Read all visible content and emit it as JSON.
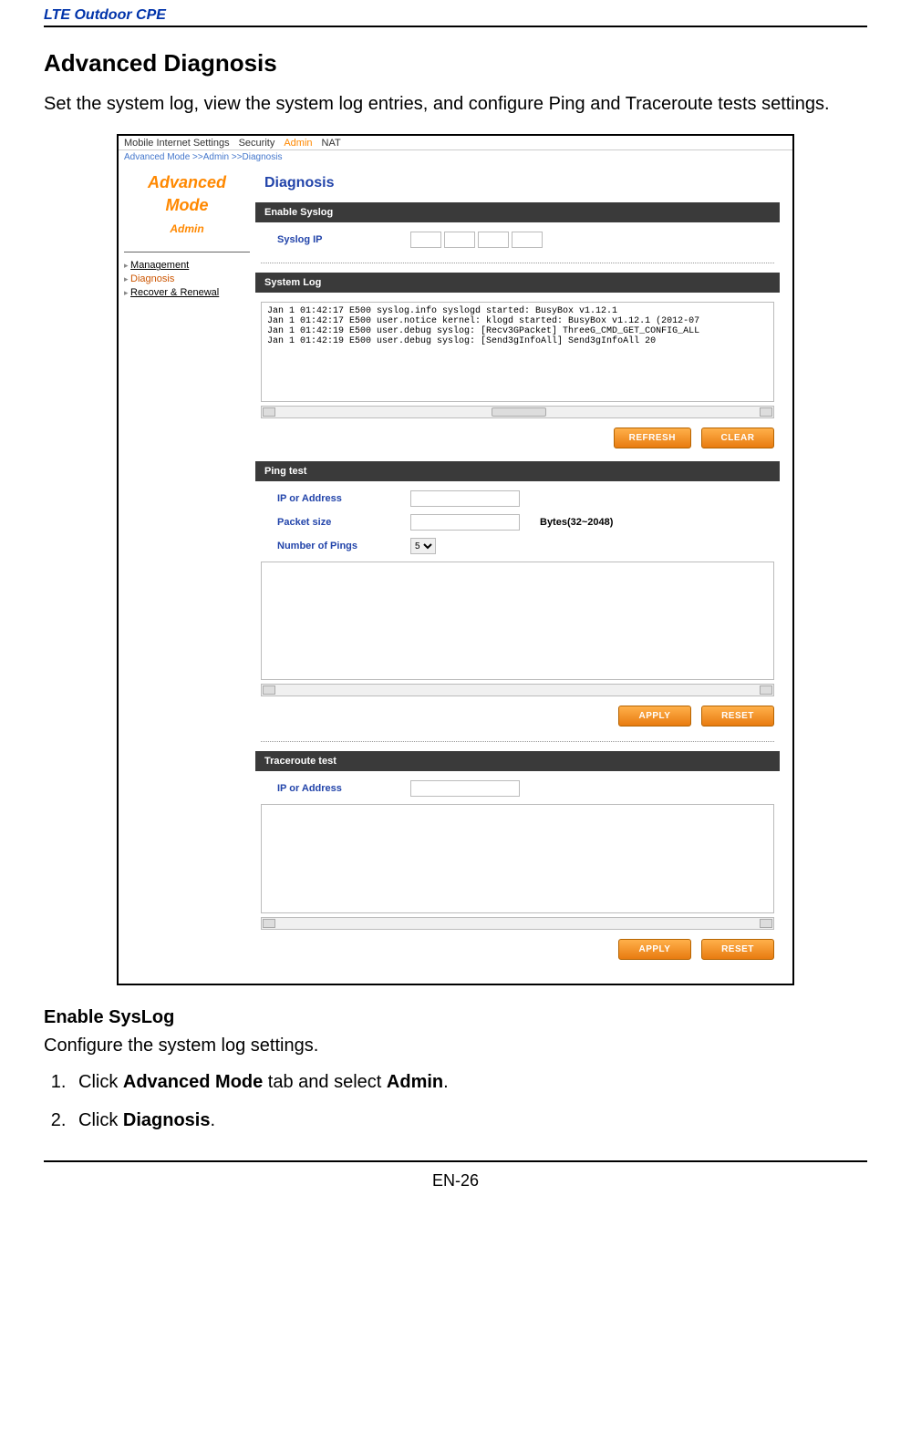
{
  "doc": {
    "header_title": "LTE Outdoor CPE",
    "section_title": "Advanced Diagnosis",
    "intro": "Set the system log, view the system log entries, and configure Ping and Traceroute tests settings.",
    "subsection_title": "Enable SysLog",
    "subsection_text": "Configure the system log settings.",
    "step1_pre": "Click ",
    "step1_b1": "Advanced Mode",
    "step1_mid": " tab and select ",
    "step1_b2": "Admin",
    "step1_post": ".",
    "step2_pre": "Click ",
    "step2_b1": "Diagnosis",
    "step2_post": ".",
    "footer": "EN-26"
  },
  "screenshot": {
    "tabs": {
      "t1": "Mobile Internet Settings",
      "t2": "Security",
      "t3": "Admin",
      "t4": "NAT"
    },
    "breadcrumb": "Advanced Mode >>Admin >>Diagnosis",
    "advmode_line1": "Advanced",
    "advmode_line2": "Mode",
    "sidebar_group": "Admin",
    "sidebar": {
      "i1": "Management",
      "i2": "Diagnosis",
      "i3": "Recover & Renewal"
    },
    "page_title": "Diagnosis",
    "sections": {
      "enable_syslog": "Enable Syslog",
      "syslog_ip_label": "Syslog IP",
      "system_log": "System Log",
      "ping_test": "Ping test",
      "traceroute_test": "Traceroute test"
    },
    "fields": {
      "ip_or_address": "IP or Address",
      "packet_size": "Packet size",
      "packet_size_note": "Bytes(32~2048)",
      "num_pings": "Number of Pings",
      "num_pings_val": "5"
    },
    "buttons": {
      "refresh": "REFRESH",
      "clear": "CLEAR",
      "apply": "APPLY",
      "reset": "RESET"
    },
    "log_lines": {
      "l1": "Jan  1 01:42:17 E500 syslog.info syslogd started: BusyBox v1.12.1",
      "l2": "Jan  1 01:42:17 E500 user.notice kernel: klogd started: BusyBox v1.12.1 (2012-07",
      "l3": "Jan  1 01:42:19 E500 user.debug syslog: [Recv3GPacket] ThreeG_CMD_GET_CONFIG_ALL",
      "l4": "Jan  1 01:42:19 E500 user.debug syslog: [Send3gInfoAll] Send3gInfoAll 20"
    }
  }
}
